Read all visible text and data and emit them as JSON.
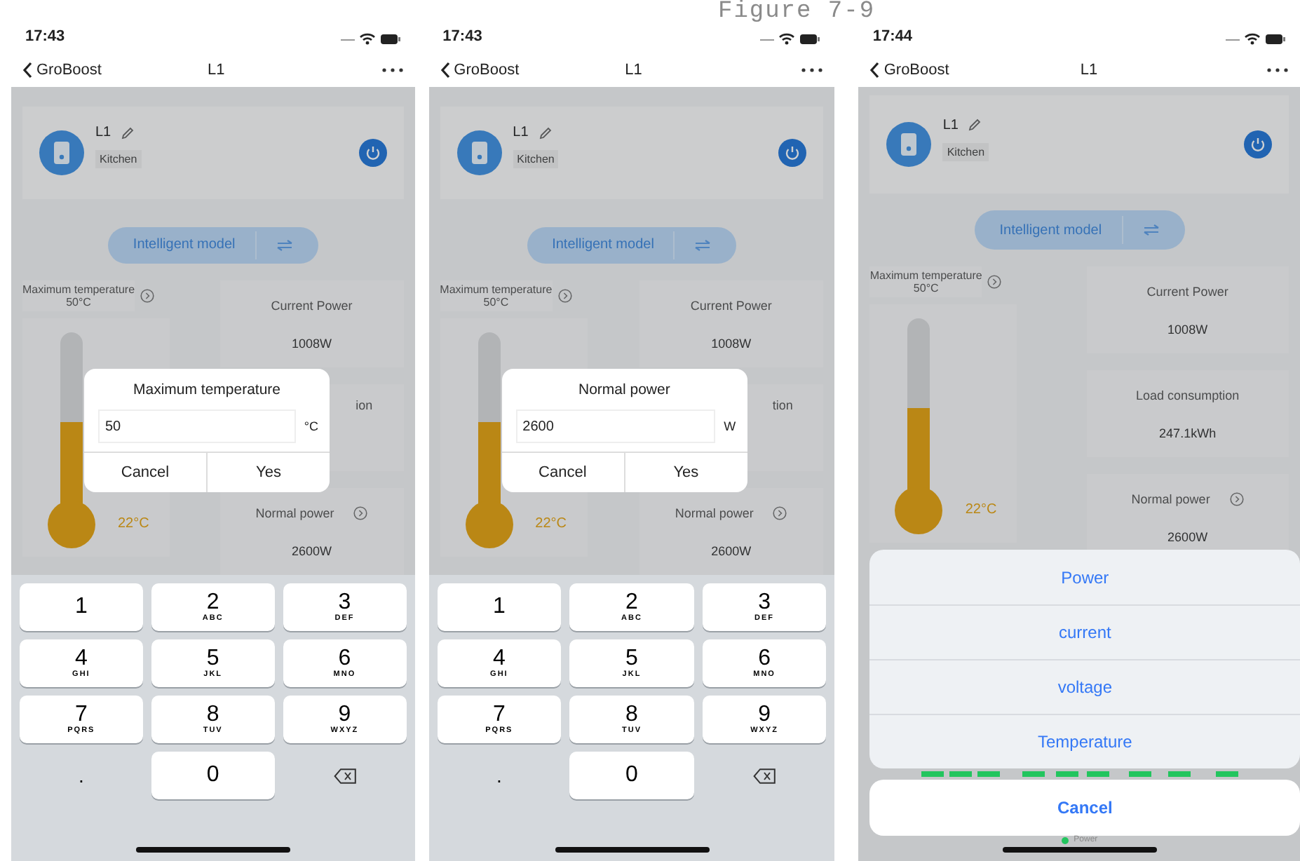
{
  "caption": "Figure 7-9",
  "phones": [
    {
      "time": "17:43",
      "back": "GroBoost",
      "title": "L1",
      "device": {
        "name": "L1",
        "room": "Kitchen"
      },
      "mode": "Intelligent model",
      "max_temp": {
        "label": "Maximum temperature",
        "value": "50°C"
      },
      "thermometer": {
        "level": 0.5,
        "reading": "22°C"
      },
      "cards": [
        {
          "kind": "full",
          "label": "Current Power",
          "value": "1008W",
          "has_arrow": false
        },
        {
          "kind": "covered",
          "label": "ion"
        },
        {
          "kind": "full",
          "label": "Normal power",
          "value": "2600W",
          "has_arrow": true
        }
      ],
      "overlay": {
        "kind": "dialog",
        "title": "Maximum temperature",
        "value": "50",
        "unit": "°C",
        "buttons": [
          "Cancel",
          "Yes"
        ]
      },
      "keypad": [
        {
          "kind": "digit",
          "digit": "1"
        },
        {
          "kind": "digit",
          "digit": "2",
          "letters": "ABC"
        },
        {
          "kind": "digit",
          "digit": "3",
          "letters": "DEF"
        },
        {
          "kind": "digit",
          "digit": "4",
          "letters": "GHI"
        },
        {
          "kind": "digit",
          "digit": "5",
          "letters": "JKL"
        },
        {
          "kind": "digit",
          "digit": "6",
          "letters": "MNO"
        },
        {
          "kind": "digit",
          "digit": "7",
          "letters": "PQRS"
        },
        {
          "kind": "digit",
          "digit": "8",
          "letters": "TUV"
        },
        {
          "kind": "digit",
          "digit": "9",
          "letters": "WXYZ"
        },
        {
          "kind": "plain",
          "digit": "."
        },
        {
          "kind": "digit",
          "digit": "0"
        },
        {
          "kind": "delete"
        }
      ]
    },
    {
      "time": "17:43",
      "back": "GroBoost",
      "title": "L1",
      "device": {
        "name": "L1",
        "room": "Kitchen"
      },
      "mode": "Intelligent model",
      "max_temp": {
        "label": "Maximum temperature",
        "value": "50°C"
      },
      "thermometer": {
        "level": 0.5,
        "reading": "22°C"
      },
      "cards": [
        {
          "kind": "full",
          "label": "Current Power",
          "value": "1008W",
          "has_arrow": false
        },
        {
          "kind": "covered",
          "label": "tion"
        },
        {
          "kind": "full",
          "label": "Normal power",
          "value": "2600W",
          "has_arrow": true
        }
      ],
      "overlay": {
        "kind": "dialog",
        "title": "Normal power",
        "value": "2600",
        "unit": "W",
        "buttons": [
          "Cancel",
          "Yes"
        ]
      },
      "keypad": [
        {
          "kind": "digit",
          "digit": "1"
        },
        {
          "kind": "digit",
          "digit": "2",
          "letters": "ABC"
        },
        {
          "kind": "digit",
          "digit": "3",
          "letters": "DEF"
        },
        {
          "kind": "digit",
          "digit": "4",
          "letters": "GHI"
        },
        {
          "kind": "digit",
          "digit": "5",
          "letters": "JKL"
        },
        {
          "kind": "digit",
          "digit": "6",
          "letters": "MNO"
        },
        {
          "kind": "digit",
          "digit": "7",
          "letters": "PQRS"
        },
        {
          "kind": "digit",
          "digit": "8",
          "letters": "TUV"
        },
        {
          "kind": "digit",
          "digit": "9",
          "letters": "WXYZ"
        },
        {
          "kind": "plain",
          "digit": "."
        },
        {
          "kind": "digit",
          "digit": "0"
        },
        {
          "kind": "delete"
        }
      ]
    },
    {
      "time": "17:44",
      "back": "GroBoost",
      "title": "L1",
      "device": {
        "name": "L1",
        "room": "Kitchen"
      },
      "mode": "Intelligent model",
      "max_temp": {
        "label": "Maximum temperature",
        "value": "50°C"
      },
      "thermometer": {
        "level": 0.5,
        "reading": "22°C"
      },
      "cards": [
        {
          "kind": "full",
          "label": "Current Power",
          "value": "1008W",
          "has_arrow": false
        },
        {
          "kind": "full",
          "label": "Load consumption",
          "value": "247.1kWh",
          "has_arrow": false
        },
        {
          "kind": "full",
          "label": "Normal power",
          "value": "2600W",
          "has_arrow": true
        }
      ],
      "chart_legend": {
        "label": "Power",
        "color": "#22c55e"
      },
      "overlay": {
        "kind": "action_sheet",
        "options": [
          "Power",
          "current",
          "voltage",
          "Temperature"
        ],
        "cancel": "Cancel"
      }
    }
  ]
}
